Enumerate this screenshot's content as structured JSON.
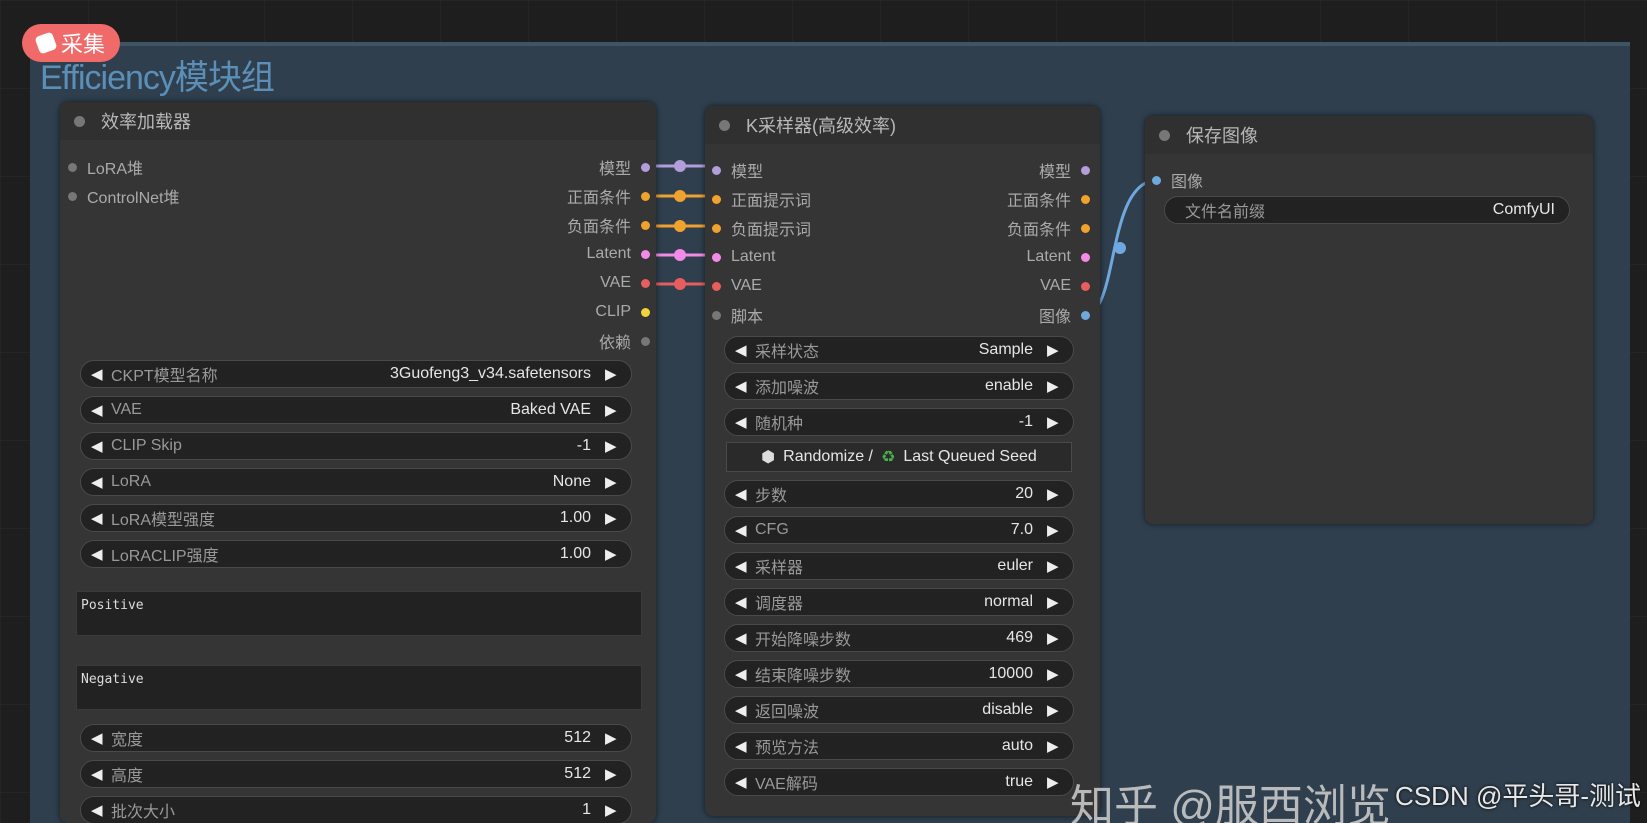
{
  "group": {
    "title": "Efficiency模块组"
  },
  "badge": {
    "label": "采集"
  },
  "watermark": {
    "csdn": "CSDN @平头哥-测试",
    "zhihu": "知乎 @服西浏览"
  },
  "loader": {
    "title": "效率加载器",
    "inputs": [
      "LoRA堆",
      "ControlNet堆"
    ],
    "outputs": [
      {
        "label": "模型",
        "color": "#b39ddb"
      },
      {
        "label": "正面条件",
        "color": "#f0a22e"
      },
      {
        "label": "负面条件",
        "color": "#f0a22e"
      },
      {
        "label": "Latent",
        "color": "#f28be8"
      },
      {
        "label": "VAE",
        "color": "#e85d5d"
      },
      {
        "label": "CLIP",
        "color": "#f2d33a"
      },
      {
        "label": "依赖",
        "color": "#777777"
      }
    ],
    "widgets": [
      {
        "label": "CKPT模型名称",
        "value": "3Guofeng3_v34.safetensors"
      },
      {
        "label": "VAE",
        "value": "Baked VAE"
      },
      {
        "label": "CLIP Skip",
        "value": "-1"
      },
      {
        "label": "LoRA",
        "value": "None"
      },
      {
        "label": "LoRA模型强度",
        "value": "1.00"
      },
      {
        "label": "LoRACLIP强度",
        "value": "1.00"
      }
    ],
    "positive": "Positive",
    "negative": "Negative",
    "widgets2": [
      {
        "label": "宽度",
        "value": "512"
      },
      {
        "label": "高度",
        "value": "512"
      },
      {
        "label": "批次大小",
        "value": "1"
      }
    ]
  },
  "sampler": {
    "title": "K采样器(高级效率)",
    "inputs": [
      {
        "label": "模型",
        "color": "#b39ddb"
      },
      {
        "label": "正面提示词",
        "color": "#f0a22e"
      },
      {
        "label": "负面提示词",
        "color": "#f0a22e"
      },
      {
        "label": "Latent",
        "color": "#f28be8"
      },
      {
        "label": "VAE",
        "color": "#e85d5d"
      },
      {
        "label": "脚本",
        "color": "#777777"
      }
    ],
    "outputs": [
      {
        "label": "模型",
        "color": "#b39ddb"
      },
      {
        "label": "正面条件",
        "color": "#f0a22e"
      },
      {
        "label": "负面条件",
        "color": "#f0a22e"
      },
      {
        "label": "Latent",
        "color": "#f28be8"
      },
      {
        "label": "VAE",
        "color": "#e85d5d"
      },
      {
        "label": "图像",
        "color": "#6fa8dc"
      }
    ],
    "widgets_top": [
      {
        "label": "采样状态",
        "value": "Sample"
      },
      {
        "label": "添加噪波",
        "value": "enable"
      },
      {
        "label": "随机种",
        "value": "-1"
      }
    ],
    "seed_button": {
      "a": "Randomize /",
      "b": "Last Queued Seed"
    },
    "widgets_bottom": [
      {
        "label": "步数",
        "value": "20"
      },
      {
        "label": "CFG",
        "value": "7.0"
      },
      {
        "label": "采样器",
        "value": "euler"
      },
      {
        "label": "调度器",
        "value": "normal"
      },
      {
        "label": "开始降噪步数",
        "value": "469"
      },
      {
        "label": "结束降噪步数",
        "value": "10000"
      },
      {
        "label": "返回噪波",
        "value": "disable"
      },
      {
        "label": "预览方法",
        "value": "auto"
      },
      {
        "label": "VAE解码",
        "value": "true"
      }
    ]
  },
  "save": {
    "title": "保存图像",
    "input": {
      "label": "图像",
      "color": "#6fa8dc"
    },
    "widget": {
      "label": "文件名前缀",
      "value": "ComfyUI"
    }
  }
}
